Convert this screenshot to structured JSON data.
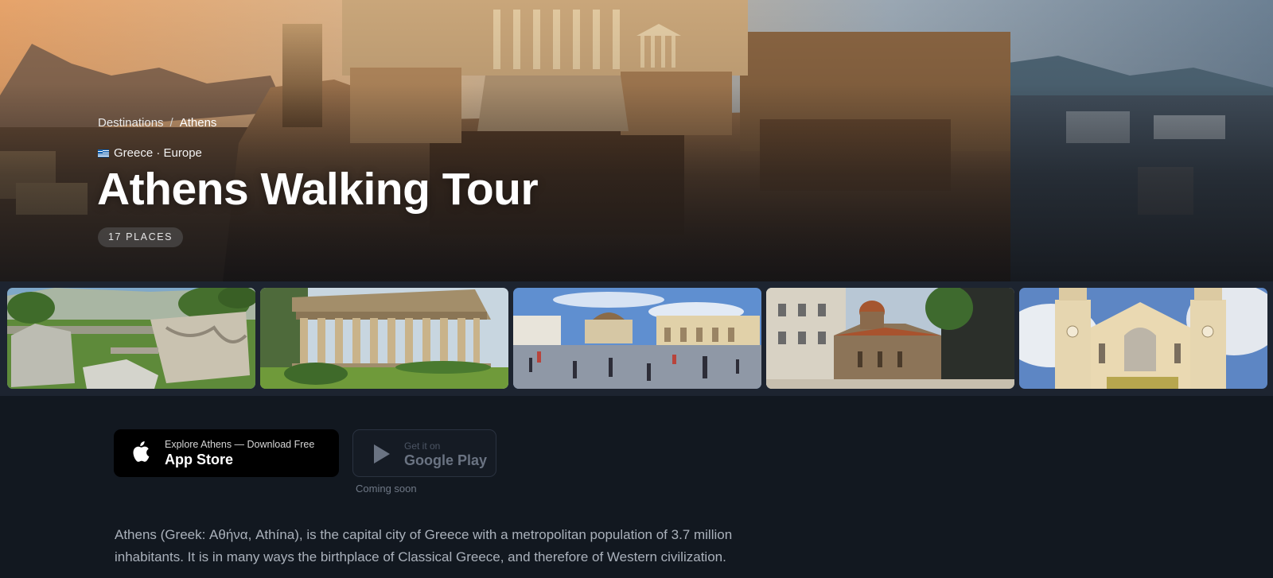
{
  "hero": {
    "breadcrumb": {
      "root": "Destinations",
      "separator": "/",
      "current": "Athens"
    },
    "location": "Greece · Europe",
    "flag_icon": "greece-flag-icon",
    "title": "Athens Walking Tour",
    "places_badge": "17 PLACES"
  },
  "gallery": {
    "photos": [
      {
        "subject": "ancient-ruins-garden"
      },
      {
        "subject": "temple-of-hephaestus"
      },
      {
        "subject": "monastiraki-square"
      },
      {
        "subject": "byzantine-church-kapnikarea"
      },
      {
        "subject": "metropolitan-cathedral"
      }
    ]
  },
  "download": {
    "app_store": {
      "small": "Explore Athens — Download Free",
      "big": "App Store",
      "icon": "apple-icon"
    },
    "google_play": {
      "small": "Get it on",
      "big": "Google Play",
      "icon": "play-icon",
      "note": "Coming soon"
    }
  },
  "description": "Athens (Greek: Αθήνα, Athína), is the capital city of Greece with a metropolitan population of 3.7 million inhabitants. It is in many ways the birthplace of Classical Greece, and therefore of Western civilization.",
  "colors": {
    "page_bg": "#121820",
    "gallery_bg": "#1d2430",
    "text_muted": "#aab1bb",
    "badge_bg": "#5a5a5a"
  }
}
